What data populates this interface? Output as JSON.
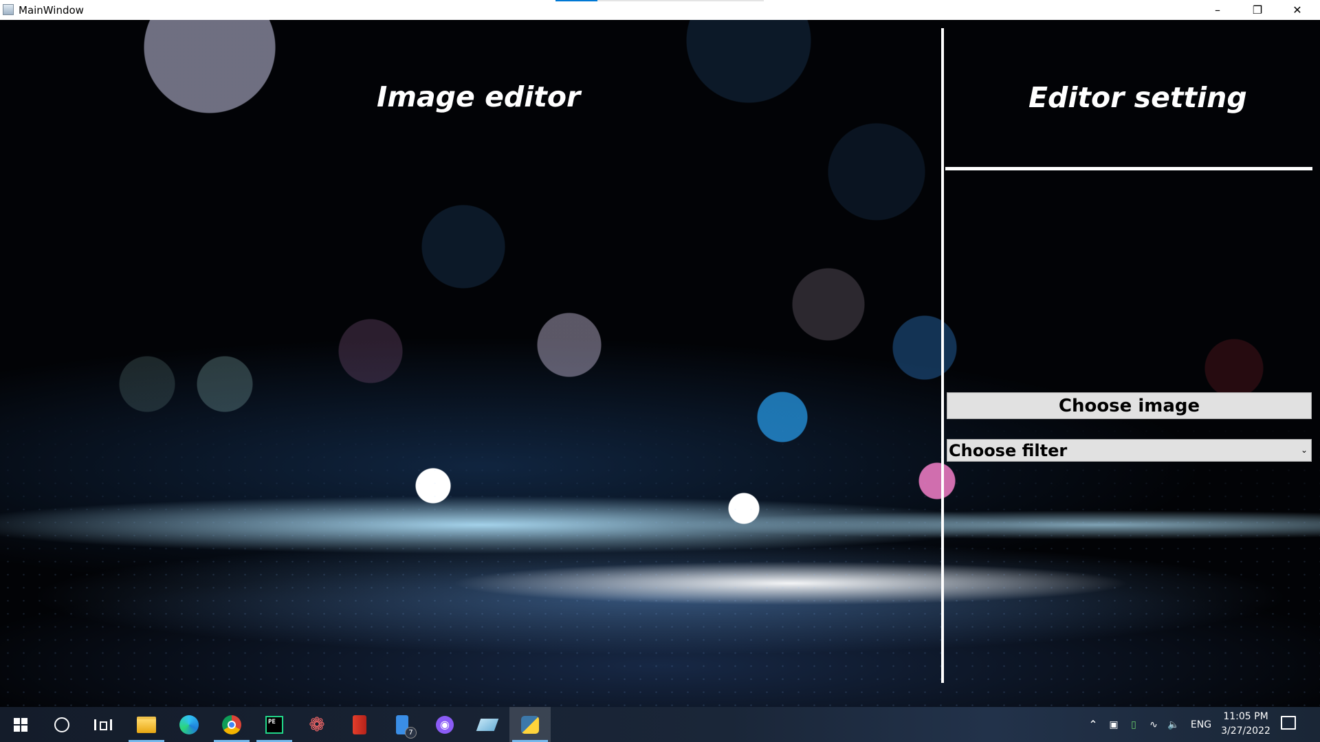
{
  "window": {
    "title": "MainWindow",
    "controls": {
      "minimize": "–",
      "maximize": "❐",
      "close": "✕"
    }
  },
  "main": {
    "left_heading": "Image editor",
    "right_heading": "Editor setting",
    "choose_image_label": "Choose image",
    "filter_select": {
      "selected": "Choose filter",
      "arrow": "⌄"
    }
  },
  "taskbar": {
    "apps": [
      {
        "name": "start",
        "icon": "windows-icon"
      },
      {
        "name": "search",
        "icon": "search-circle-icon"
      },
      {
        "name": "task-view",
        "icon": "task-view-icon"
      },
      {
        "name": "file-explorer",
        "icon": "folder-icon",
        "running": true
      },
      {
        "name": "edge",
        "icon": "edge-icon"
      },
      {
        "name": "chrome",
        "icon": "chrome-icon",
        "running": true
      },
      {
        "name": "pycharm",
        "icon": "pycharm-icon",
        "running": true,
        "glyph": "PE"
      },
      {
        "name": "app-gear",
        "icon": "gear-icon"
      },
      {
        "name": "office",
        "icon": "office-icon"
      },
      {
        "name": "phone-app",
        "icon": "phone-icon",
        "badge": "7"
      },
      {
        "name": "github",
        "icon": "github-icon"
      },
      {
        "name": "eraser",
        "icon": "eraser-icon"
      },
      {
        "name": "python",
        "icon": "python-icon",
        "running": true,
        "focused": true
      }
    ],
    "tray": {
      "language": "ENG",
      "time": "11:05 PM",
      "date": "3/27/2022"
    }
  }
}
